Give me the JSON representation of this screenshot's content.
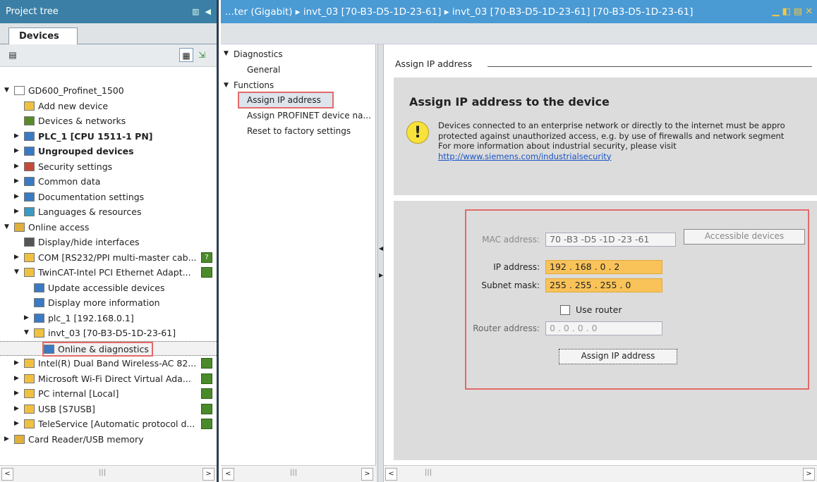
{
  "project_tree": {
    "title": "Project tree",
    "tab": "Devices",
    "items": [
      {
        "label": "GD600_Profinet_1500",
        "exp": "▼",
        "depth": 0,
        "icon": "project-icon",
        "bold": false
      },
      {
        "label": "Add new device",
        "exp": "",
        "depth": 1,
        "icon": "add-device-icon",
        "bold": false
      },
      {
        "label": "Devices & networks",
        "exp": "",
        "depth": 1,
        "icon": "network-icon",
        "bold": false
      },
      {
        "label": "PLC_1 [CPU 1511-1 PN]",
        "exp": "▶",
        "depth": 1,
        "icon": "plc-icon",
        "bold": true
      },
      {
        "label": "Ungrouped devices",
        "exp": "▶",
        "depth": 1,
        "icon": "group-icon",
        "bold": true
      },
      {
        "label": "Security settings",
        "exp": "▶",
        "depth": 1,
        "icon": "security-icon",
        "bold": false
      },
      {
        "label": "Common data",
        "exp": "▶",
        "depth": 1,
        "icon": "common-data-icon",
        "bold": false
      },
      {
        "label": "Documentation settings",
        "exp": "▶",
        "depth": 1,
        "icon": "documentation-icon",
        "bold": false
      },
      {
        "label": "Languages & resources",
        "exp": "▶",
        "depth": 1,
        "icon": "languages-icon",
        "bold": false
      },
      {
        "label": "Online access",
        "exp": "▼",
        "depth": 0,
        "icon": "online-access-icon",
        "bold": false
      },
      {
        "label": "Display/hide interfaces",
        "exp": "",
        "depth": 1,
        "icon": "filter-icon",
        "bold": false
      },
      {
        "label": "COM [RS232/PPI multi-master cab...",
        "exp": "▶",
        "depth": 1,
        "icon": "folder-icon",
        "bold": false,
        "status": "unknown"
      },
      {
        "label": "TwinCAT-Intel PCI Ethernet Adapt...",
        "exp": "▼",
        "depth": 1,
        "icon": "folder-icon",
        "bold": false,
        "status": "ok"
      },
      {
        "label": "Update accessible devices",
        "exp": "",
        "depth": 2,
        "icon": "update-devices-icon",
        "bold": false
      },
      {
        "label": "Display more information",
        "exp": "",
        "depth": 2,
        "icon": "info-icon",
        "bold": false
      },
      {
        "label": "plc_1 [192.168.0.1]",
        "exp": "▶",
        "depth": 2,
        "icon": "plc-icon",
        "bold": false
      },
      {
        "label": "invt_03 [70-B3-D5-1D-23-61]",
        "exp": "▼",
        "depth": 2,
        "icon": "device-icon",
        "bold": false
      },
      {
        "label": "Online & diagnostics",
        "exp": "",
        "depth": 3,
        "icon": "diagnostics-icon",
        "bold": false,
        "selected": true
      },
      {
        "label": "Intel(R) Dual Band Wireless-AC 82...",
        "exp": "▶",
        "depth": 1,
        "icon": "folder-icon",
        "bold": false,
        "status": "ok"
      },
      {
        "label": "Microsoft Wi-Fi Direct Virtual Ada...",
        "exp": "▶",
        "depth": 1,
        "icon": "folder-icon",
        "bold": false,
        "status": "ok"
      },
      {
        "label": "PC internal [Local]",
        "exp": "▶",
        "depth": 1,
        "icon": "folder-icon",
        "bold": false,
        "status": "ok"
      },
      {
        "label": "USB [S7USB]",
        "exp": "▶",
        "depth": 1,
        "icon": "folder-icon",
        "bold": false,
        "status": "ok"
      },
      {
        "label": "TeleService [Automatic protocol d...",
        "exp": "▶",
        "depth": 1,
        "icon": "folder-icon",
        "bold": false,
        "status": "ok"
      },
      {
        "label": "Card Reader/USB memory",
        "exp": "▶",
        "depth": 0,
        "icon": "card-reader-icon",
        "bold": false
      }
    ]
  },
  "editor": {
    "breadcrumb": "...ter (Gigabit)  ▸  invt_03 [70-B3-D5-1D-23-61]  ▸  invt_03 [70-B3-D5-1D-23-61] [70-B3-D5-1D-23-61]",
    "nav": {
      "diagnostics": "Diagnostics",
      "general": "General",
      "functions": "Functions",
      "assign_ip": "Assign IP address",
      "assign_name": "Assign PROFINET device na...",
      "reset": "Reset to factory settings"
    },
    "section_title": "Assign IP address",
    "heading": "Assign IP address to the device",
    "warning_lines": [
      "Devices connected to an enterprise network or directly to the internet must be appro",
      "protected against unauthorized access, e.g. by use of firewalls and network segment",
      "For more information about industrial security, please visit"
    ],
    "link": "http://www.siemens.com/industrialsecurity",
    "form": {
      "mac_label": "MAC address:",
      "mac_value": "70 -B3 -D5 -1D -23 -61",
      "accessible_btn": "Accessible devices",
      "ip_label": "IP address:",
      "ip_value": "192 . 168 . 0   . 2",
      "subnet_label": "Subnet mask:",
      "subnet_value": "255 . 255 . 255 . 0",
      "use_router": "Use router",
      "router_label": "Router address:",
      "router_value": "0    . 0    . 0    . 0",
      "assign_btn": "Assign IP address"
    }
  }
}
